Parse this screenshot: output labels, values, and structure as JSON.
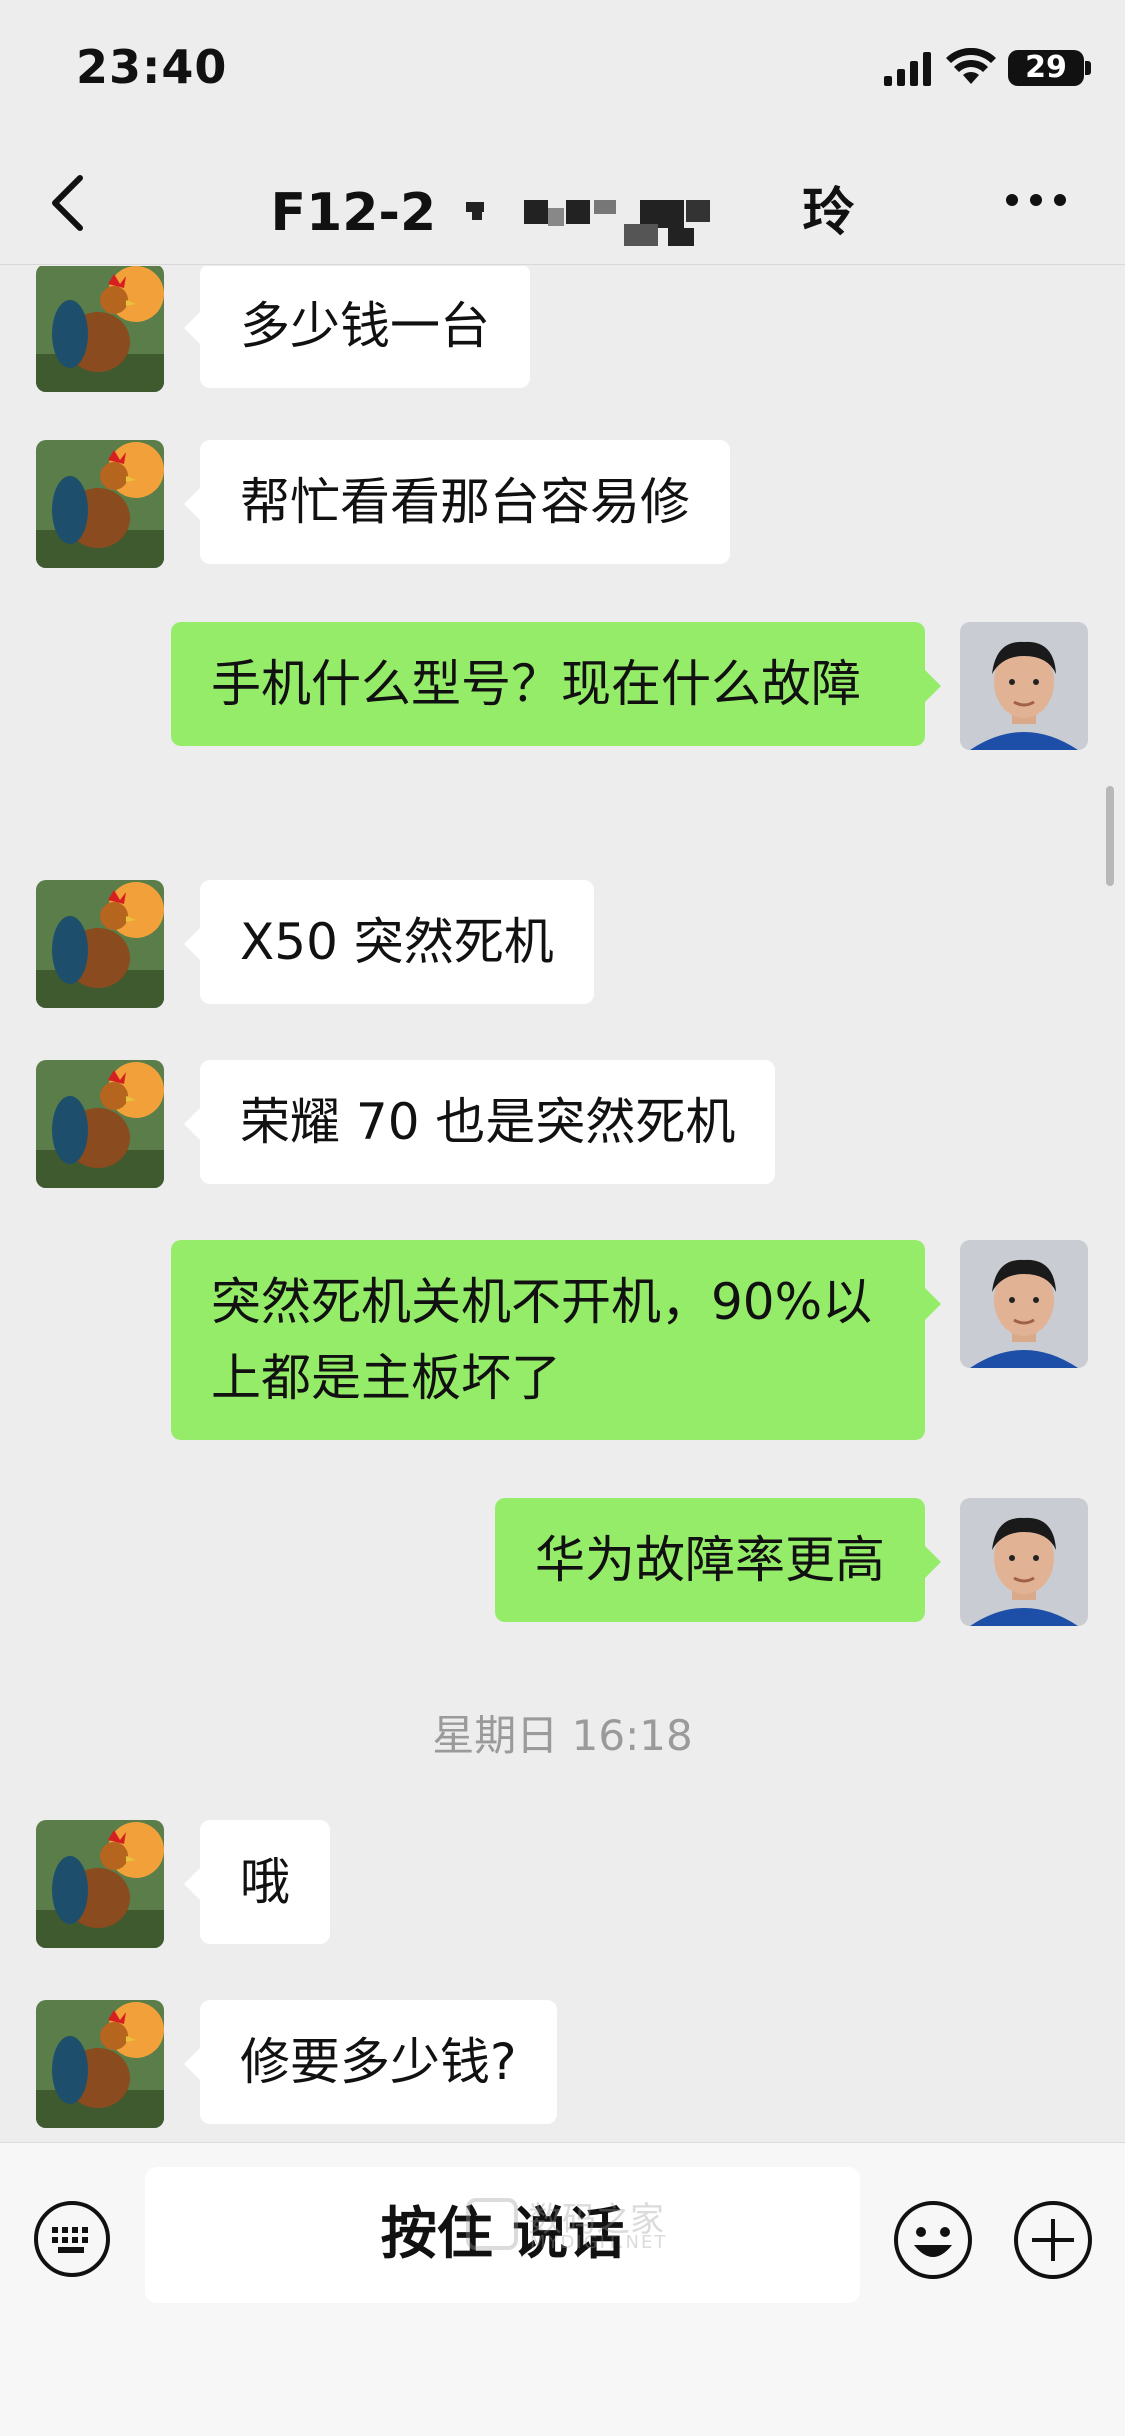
{
  "status_bar": {
    "time": "23:40",
    "battery": "29"
  },
  "nav": {
    "title_prefix": "F12-2",
    "title_suffix": "玲"
  },
  "messages": [
    {
      "side": "in",
      "text": "多少钱一台"
    },
    {
      "side": "in",
      "text": "帮忙看看那台容易修"
    },
    {
      "side": "out",
      "text": "手机什么型号？现在什么故障"
    },
    {
      "side": "in",
      "text": "X50 突然死机"
    },
    {
      "side": "in",
      "text": "荣耀 70 也是突然死机"
    },
    {
      "side": "out",
      "text": "突然死机关机不开机，90%以上都是主板坏了"
    },
    {
      "side": "out",
      "text": "华为故障率更高"
    },
    {
      "side": "in",
      "text": "哦"
    },
    {
      "side": "in",
      "text": "修要多少钱?"
    }
  ],
  "timestamp": "星期日 16:18",
  "input": {
    "voice_label": "按住 说话"
  },
  "watermark": {
    "main": "数码之家",
    "sub": "MYDIGIT.NET"
  },
  "colors": {
    "background": "#ededed",
    "outgoing_bubble": "#95ec69",
    "incoming_bubble": "#ffffff"
  },
  "icons": [
    "back-icon",
    "more-icon",
    "keyboard-icon",
    "emoji-icon",
    "plus-icon",
    "signal-icon",
    "wifi-icon",
    "battery-icon"
  ]
}
